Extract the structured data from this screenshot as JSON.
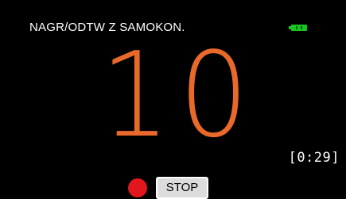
{
  "header": {
    "mode_title": "NAGR/ODTW Z SAMOKON."
  },
  "status": {
    "battery_icon": "battery-full-icon",
    "battery_color": "#18c51f"
  },
  "main": {
    "countdown": "10",
    "countdown_color": "#e8692a",
    "remaining_time": "[0:29]"
  },
  "controls": {
    "record_indicator_icon": "record-dot-icon",
    "record_color": "#e1171d",
    "stop_label": "STOP"
  }
}
